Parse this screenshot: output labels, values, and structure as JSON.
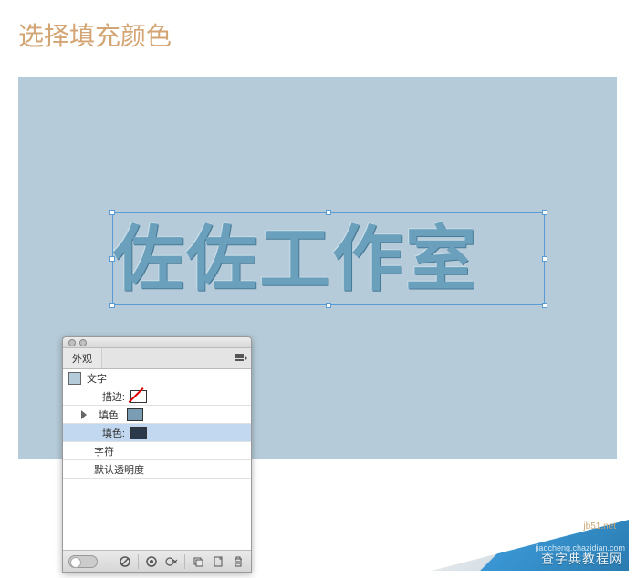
{
  "page": {
    "title": "选择填充颜色"
  },
  "canvas": {
    "text": "佐佐工作室"
  },
  "panel": {
    "tab": "外观",
    "rows": {
      "type_label": "文字",
      "stroke_label": "描边:",
      "fill1_label": "填色:",
      "fill2_label": "填色:",
      "chars_label": "字符",
      "opacity_label": "默认透明度"
    }
  },
  "watermark": {
    "site": "jb51.net",
    "sub": "jiaocheng.chazidian.com",
    "brand": "查字典教程网"
  }
}
